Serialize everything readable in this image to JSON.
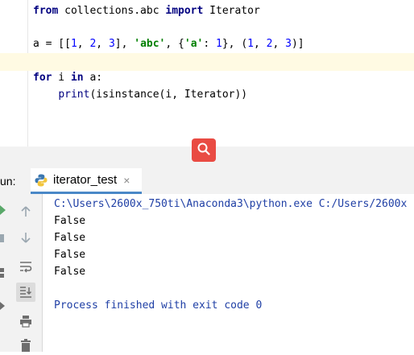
{
  "editor": {
    "line1": {
      "kw1": "from",
      "module": " collections.abc ",
      "kw2": "import",
      "name": " Iterator"
    },
    "line2": {
      "lhs": "a = [[",
      "n1": "1",
      "sep1": ", ",
      "n2": "2",
      "sep2": ", ",
      "n3": "3",
      "mid1": "], ",
      "s1": "'abc'",
      "mid2": ", {",
      "k1": "'a'",
      "colon": ": ",
      "n4": "1",
      "mid3": "}, (",
      "n5": "1",
      "sep3": ", ",
      "n6": "2",
      "sep4": ", ",
      "n7": "3",
      "end": ")]"
    },
    "line3": {
      "kw1": "for",
      "var": " i ",
      "kw2": "in",
      "rest": " a:"
    },
    "line4": {
      "indent": "    ",
      "fn": "print",
      "args": "(isinstance(i, Iterator))"
    }
  },
  "run_panel": {
    "label": "un:",
    "tab_title": "iterator_test",
    "tab_close": "×",
    "icon_names": [
      "up-arrow-icon",
      "down-arrow-icon",
      "soft-wrap-icon",
      "scroll-to-end-icon",
      "print-icon",
      "trash-icon"
    ]
  },
  "console": {
    "command": "C:\\Users\\2600x_750ti\\Anaconda3\\python.exe C:/Users/2600x",
    "output": [
      "False",
      "False",
      "False",
      "False"
    ],
    "exit_message": "Process finished with exit code 0"
  },
  "colors": {
    "accent_tab": "#4a88c7",
    "search_button": "#e94b43",
    "caret_row": "#fffae3"
  }
}
